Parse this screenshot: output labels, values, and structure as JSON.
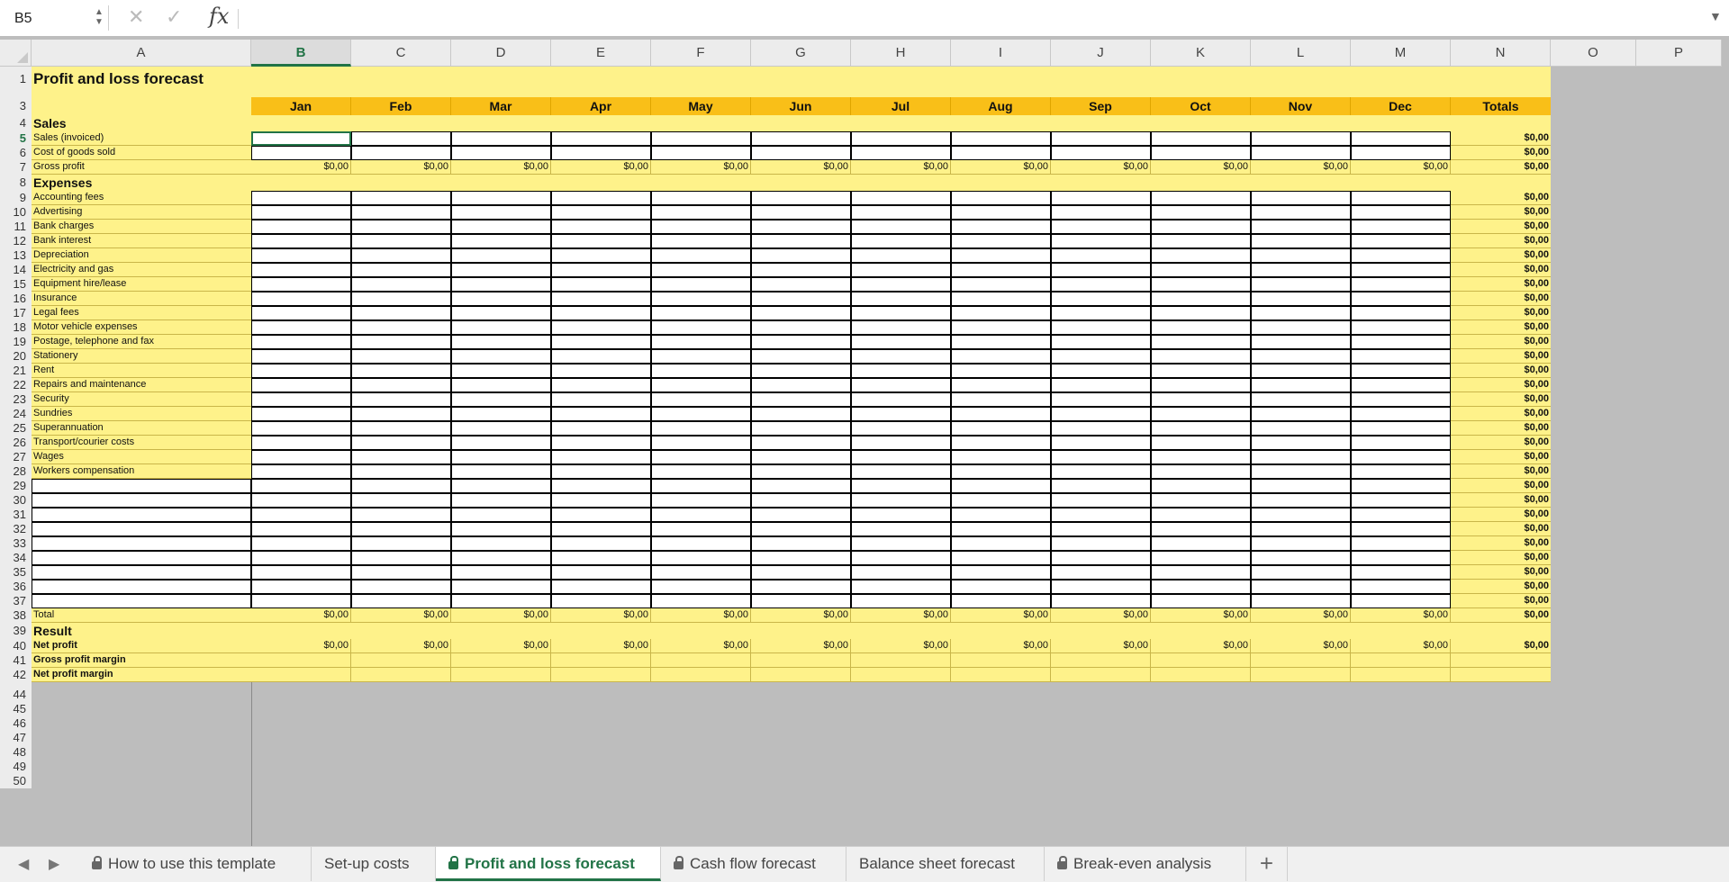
{
  "formula_bar": {
    "name_box": "B5",
    "formula_value": "",
    "icons": {
      "cancel": "x-icon",
      "confirm": "check-icon",
      "function": "fx-icon",
      "dropdown": "chevron-down-icon"
    }
  },
  "columns": [
    "A",
    "B",
    "C",
    "D",
    "E",
    "F",
    "G",
    "H",
    "I",
    "J",
    "K",
    "L",
    "M",
    "N",
    "O",
    "P"
  ],
  "active_column": "B",
  "active_row": "5",
  "sheet": {
    "title": "Profit and loss forecast",
    "months": [
      "Jan",
      "Feb",
      "Mar",
      "Apr",
      "May",
      "Jun",
      "Jul",
      "Aug",
      "Sep",
      "Oct",
      "Nov",
      "Dec"
    ],
    "totals_header": "Totals",
    "sales_header": "Sales",
    "sales_rows": [
      {
        "row": "5",
        "label": "Sales (invoiced)",
        "monthly": "",
        "total": "$0,00"
      },
      {
        "row": "6",
        "label": "Cost of goods sold",
        "monthly": "",
        "total": "$0,00"
      },
      {
        "row": "7",
        "label": "Gross profit",
        "monthly": "$0,00",
        "total": "$0,00"
      }
    ],
    "expenses_header": "Expenses",
    "expense_rows": [
      {
        "row": "9",
        "label": "Accounting fees",
        "total": "$0,00"
      },
      {
        "row": "10",
        "label": "Advertising",
        "total": "$0,00"
      },
      {
        "row": "11",
        "label": "Bank charges",
        "total": "$0,00"
      },
      {
        "row": "12",
        "label": "Bank interest",
        "total": "$0,00"
      },
      {
        "row": "13",
        "label": "Depreciation",
        "total": "$0,00"
      },
      {
        "row": "14",
        "label": "Electricity and gas",
        "total": "$0,00"
      },
      {
        "row": "15",
        "label": "Equipment hire/lease",
        "total": "$0,00"
      },
      {
        "row": "16",
        "label": "Insurance",
        "total": "$0,00"
      },
      {
        "row": "17",
        "label": "Legal fees",
        "total": "$0,00"
      },
      {
        "row": "18",
        "label": "Motor vehicle expenses",
        "total": "$0,00"
      },
      {
        "row": "19",
        "label": "Postage, telephone and fax",
        "total": "$0,00"
      },
      {
        "row": "20",
        "label": "Stationery",
        "total": "$0,00"
      },
      {
        "row": "21",
        "label": "Rent",
        "total": "$0,00"
      },
      {
        "row": "22",
        "label": "Repairs and maintenance",
        "total": "$0,00"
      },
      {
        "row": "23",
        "label": "Security",
        "total": "$0,00"
      },
      {
        "row": "24",
        "label": "Sundries",
        "total": "$0,00"
      },
      {
        "row": "25",
        "label": "Superannuation",
        "total": "$0,00"
      },
      {
        "row": "26",
        "label": "Transport/courier costs",
        "total": "$0,00"
      },
      {
        "row": "27",
        "label": "Wages",
        "total": "$0,00"
      },
      {
        "row": "28",
        "label": "Workers compensation",
        "total": "$0,00"
      },
      {
        "row": "29",
        "label": "",
        "total": "$0,00"
      },
      {
        "row": "30",
        "label": "",
        "total": "$0,00"
      },
      {
        "row": "31",
        "label": "",
        "total": "$0,00"
      },
      {
        "row": "32",
        "label": "",
        "total": "$0,00"
      },
      {
        "row": "33",
        "label": "",
        "total": "$0,00"
      },
      {
        "row": "34",
        "label": "",
        "total": "$0,00"
      },
      {
        "row": "35",
        "label": "",
        "total": "$0,00"
      },
      {
        "row": "36",
        "label": "",
        "total": "$0,00"
      },
      {
        "row": "37",
        "label": "",
        "total": "$0,00"
      }
    ],
    "total_row": {
      "row": "38",
      "label": "Total",
      "monthly": "$0,00",
      "total": "$0,00"
    },
    "result_header": "Result",
    "result_rows": [
      {
        "row": "40",
        "label": "Net profit",
        "monthly": "$0,00",
        "total": "$0,00"
      },
      {
        "row": "41",
        "label": "Gross profit margin",
        "monthly": "",
        "total": ""
      },
      {
        "row": "42",
        "label": "Net profit margin",
        "monthly": "",
        "total": ""
      }
    ],
    "extra_row_numbers": [
      "44",
      "45",
      "46",
      "47",
      "48",
      "49",
      "50"
    ]
  },
  "tabs": {
    "nav": {
      "prev": "chevron-left-icon",
      "next": "chevron-right-icon"
    },
    "items": [
      {
        "label": "How to use this template",
        "locked": true,
        "active": false
      },
      {
        "label": "Set-up costs",
        "locked": false,
        "active": false
      },
      {
        "label": "Profit and loss forecast",
        "locked": true,
        "active": true
      },
      {
        "label": "Cash flow forecast",
        "locked": true,
        "active": false
      },
      {
        "label": "Balance sheet forecast",
        "locked": false,
        "active": false
      },
      {
        "label": "Break-even analysis",
        "locked": true,
        "active": false
      }
    ],
    "add_label": "+"
  },
  "colors": {
    "sheet_fill": "#fef28a",
    "month_header_fill": "#f9bf18",
    "accent": "#217346",
    "outside_sheet": "#bdbdbd"
  }
}
